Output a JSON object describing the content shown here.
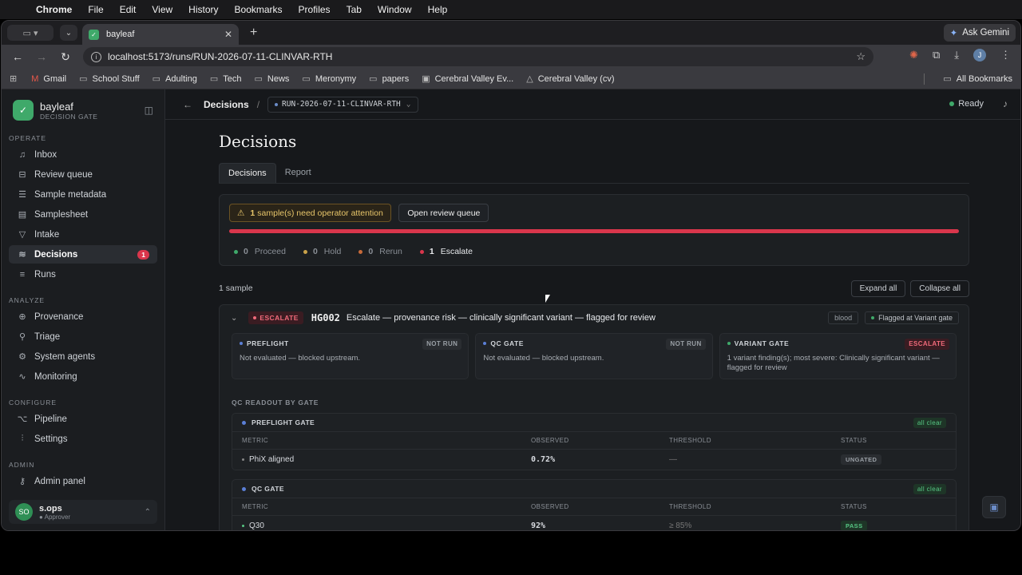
{
  "menubar": {
    "app": "Chrome",
    "items": [
      "File",
      "Edit",
      "View",
      "History",
      "Bookmarks",
      "Profiles",
      "Tab",
      "Window",
      "Help"
    ]
  },
  "browser": {
    "tab_title": "bayleaf",
    "url": "localhost:5173/runs/RUN-2026-07-11-CLINVAR-RTH",
    "ask_gemini": "Ask Gemini",
    "profile_initial": "J",
    "bookmarks": [
      "Gmail",
      "School Stuff",
      "Adulting",
      "Tech",
      "News",
      "Meronymy",
      "papers",
      "Cerebral Valley Ev...",
      "Cerebral Valley (cv)"
    ],
    "all_bookmarks": "All Bookmarks"
  },
  "sidebar": {
    "brand": "bayleaf",
    "brand_sub": "DECISION GATE",
    "operate_label": "OPERATE",
    "operate": [
      {
        "label": "Inbox",
        "icon": "bell-icon"
      },
      {
        "label": "Review queue",
        "icon": "inbox-icon"
      },
      {
        "label": "Sample metadata",
        "icon": "list-icon"
      },
      {
        "label": "Samplesheet",
        "icon": "sheet-icon"
      },
      {
        "label": "Intake",
        "icon": "filter-icon"
      },
      {
        "label": "Decisions",
        "icon": "stack-icon",
        "badge": "1"
      },
      {
        "label": "Runs",
        "icon": "runs-icon"
      }
    ],
    "analyze_label": "ANALYZE",
    "analyze": [
      {
        "label": "Provenance",
        "icon": "globe-icon"
      },
      {
        "label": "Triage",
        "icon": "triage-icon"
      },
      {
        "label": "System agents",
        "icon": "agents-icon"
      },
      {
        "label": "Monitoring",
        "icon": "pulse-icon"
      }
    ],
    "configure_label": "CONFIGURE",
    "configure": [
      {
        "label": "Pipeline",
        "icon": "pipeline-icon"
      },
      {
        "label": "Settings",
        "icon": "sliders-icon"
      }
    ],
    "admin_label": "ADMIN",
    "admin": [
      {
        "label": "Admin panel",
        "icon": "admin-icon"
      }
    ],
    "user": {
      "initials": "SO",
      "name": "s.ops",
      "role": "Approver"
    }
  },
  "topbar": {
    "crumb": "Decisions",
    "run": "RUN-2026-07-11-CLINVAR-RTH",
    "status": "Ready"
  },
  "page": {
    "title": "Decisions",
    "tabs": [
      "Decisions",
      "Report"
    ],
    "attention_count": "1",
    "attention_text": "sample(s) need operator attention",
    "open_review": "Open review queue",
    "counts": [
      {
        "n": "0",
        "label": "Proceed",
        "color": "#3fa96a"
      },
      {
        "n": "0",
        "label": "Hold",
        "color": "#c9a24a"
      },
      {
        "n": "0",
        "label": "Rerun",
        "color": "#c76a3a"
      },
      {
        "n": "1",
        "label": "Escalate",
        "color": "#d9364c"
      }
    ],
    "sample_count": "1 sample",
    "expand_all": "Expand all",
    "collapse_all": "Collapse all"
  },
  "sample": {
    "decision": "ESCALATE",
    "id": "HG002",
    "summary": "Escalate — provenance risk — clinically significant variant — flagged for review",
    "tissue": "blood",
    "flag": "Flagged at Variant gate",
    "gates": [
      {
        "name": "PREFLIGHT",
        "status": "NOT RUN",
        "detail": "Not evaluated — blocked upstream.",
        "dot": "#5b7fd6"
      },
      {
        "name": "QC GATE",
        "status": "NOT RUN",
        "detail": "Not evaluated — blocked upstream.",
        "dot": "#5b7fd6"
      },
      {
        "name": "VARIANT GATE",
        "status": "ESCALATE",
        "detail": "1 variant finding(s); most severe: Clinically significant variant — flagged for review",
        "dot": "#3fa96a"
      }
    ],
    "qc_title": "QC READOUT BY GATE",
    "col_headers": [
      "METRIC",
      "OBSERVED",
      "THRESHOLD",
      "STATUS"
    ],
    "preflight": {
      "name": "PREFLIGHT GATE",
      "badge": "all clear",
      "rows": [
        {
          "metric": "PhiX aligned",
          "observed": "0.72%",
          "threshold": "—",
          "status": "UNGATED"
        }
      ]
    },
    "qc": {
      "name": "QC GATE",
      "badge": "all clear",
      "rows": [
        {
          "metric": "Q30",
          "observed": "92%",
          "threshold": "≥ 85%",
          "status": "PASS"
        }
      ]
    }
  }
}
